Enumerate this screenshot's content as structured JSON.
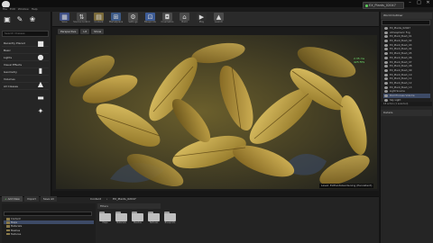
{
  "window": {
    "project_tab": "EX_Plants_02047",
    "menu": [
      "File",
      "Edit",
      "Window",
      "Help"
    ],
    "controls": [
      "–",
      "□",
      "✕"
    ]
  },
  "modes": {
    "tabs": [
      {
        "icon": "place-mode-icon",
        "glyph": "▣"
      },
      {
        "icon": "paint-mode-icon",
        "glyph": "✎"
      },
      {
        "icon": "foliage-mode-icon",
        "glyph": "❀"
      }
    ],
    "search_placeholder": "Search Classes",
    "categories": [
      "Recently Placed",
      "Basic",
      "Lights",
      "Visual Effects",
      "Geometry",
      "Volumes",
      "All Classes"
    ],
    "asset_icons": [
      "cube-icon",
      "sphere-icon",
      "cylinder-icon",
      "cone-icon",
      "plane-icon",
      "light-icon"
    ]
  },
  "toolbar": {
    "buttons": [
      {
        "label": "Save",
        "icon": "save-icon",
        "glyph": "▦",
        "color": "#3e4f86"
      },
      {
        "label": "Source Control",
        "icon": "source-control-icon",
        "glyph": "⇅",
        "color": "#444444"
      },
      {
        "label": "Content",
        "icon": "content-icon",
        "glyph": "▤",
        "color": "#7a6a3a"
      },
      {
        "label": "Marketplace",
        "icon": "marketplace-icon",
        "glyph": "⊞",
        "color": "#3d5a86"
      },
      {
        "label": "Settings",
        "icon": "settings-icon",
        "glyph": "⚙",
        "color": "#4a4a4a"
      },
      {
        "label": "Blueprints",
        "icon": "blueprints-icon",
        "glyph": "⊡",
        "color": "#3e5c96"
      },
      {
        "label": "Cinematics",
        "icon": "cinematics-icon",
        "glyph": "◘",
        "color": "#4a4a4a"
      },
      {
        "label": "Build",
        "icon": "build-icon",
        "glyph": "⌂",
        "color": "#4a4a4a"
      },
      {
        "label": "Play",
        "icon": "play-icon",
        "glyph": "▶",
        "color": "#2e2e2e"
      },
      {
        "label": "Launch",
        "icon": "launch-icon",
        "glyph": "▲",
        "color": "#4a4a4a"
      }
    ]
  },
  "viewport": {
    "buttons": [
      "Perspective",
      "Lit",
      "Show"
    ],
    "stat_lines": [
      "2.35 ms",
      "425 FPS"
    ],
    "caption": "Level: ExPlantsGardening (Persistent)"
  },
  "outliner": {
    "title": "World Outliner",
    "items": [
      "EX_Plants_02047",
      "Atmospheric Fog",
      "EX_Plant_Bush_01",
      "EX_Plant_Bush_02",
      "EX_Plant_Bush_03",
      "EX_Plant_Bush_04",
      "EX_Plant_Bush_05",
      "EX_Plant_Bush_06",
      "EX_Plant_Bush_07",
      "EX_Plant_Bush_08",
      "EX_Plant_Bush_09",
      "EX_Plant_Bush_10",
      "EX_Plant_Bush_11",
      "EX_Plant_Bush_12",
      "EX_Plant_Bush_13",
      "Light Source",
      "Post Process Volume",
      "Sky Light"
    ],
    "selected_index": 16,
    "footer": "18 actors (1 selected)",
    "details_tab": "Details"
  },
  "content_browser": {
    "tabs": [
      "Add New",
      "Import",
      "Save All"
    ],
    "path": [
      "Content",
      "EX_Plants_02047"
    ],
    "filter": "Filters",
    "tree": [
      "Content",
      "Maps",
      "Materials",
      "Meshes",
      "Textures"
    ],
    "selected_tree_index": 1,
    "folders": [
      "Maps",
      "Materials",
      "Meshes",
      "Textures",
      "Blueprints"
    ]
  }
}
